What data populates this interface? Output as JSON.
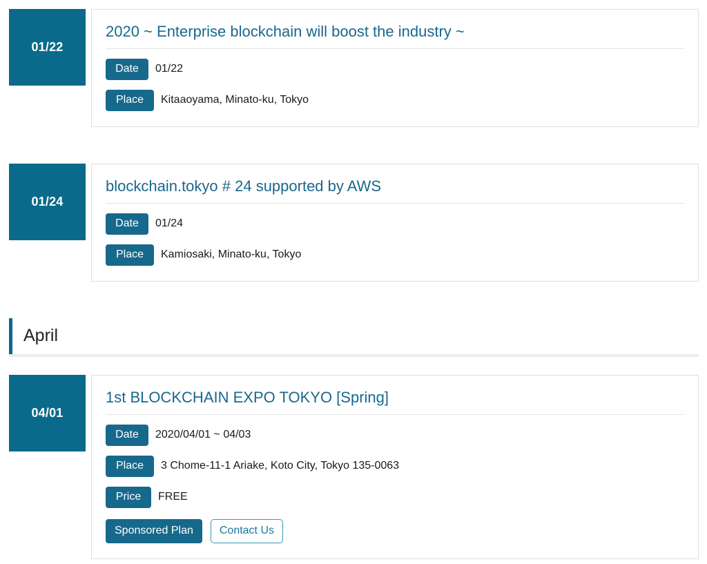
{
  "colors": {
    "accent": "#0a6a8b",
    "badge": "#17698c",
    "title_link": "#19688c",
    "outline_button_border": "#2f9cb4",
    "outline_button_text": "#19799a",
    "card_border": "#dedede",
    "divider": "#eaecec"
  },
  "sections": [
    {
      "type": "event",
      "date_block": "01/22",
      "title": "2020 ~ Enterprise blockchain will boost the industry ~",
      "meta": [
        {
          "label": "Date",
          "value": "01/22"
        },
        {
          "label": "Place",
          "value": "Kitaaoyama, Minato-ku, Tokyo"
        }
      ],
      "actions": []
    },
    {
      "type": "event",
      "date_block": "01/24",
      "title": "blockchain.tokyo # 24 supported by AWS",
      "meta": [
        {
          "label": "Date",
          "value": "01/24"
        },
        {
          "label": "Place",
          "value": "Kamiosaki, Minato-ku, Tokyo"
        }
      ],
      "actions": []
    },
    {
      "type": "month",
      "name": "April"
    },
    {
      "type": "event",
      "date_block": "04/01",
      "title": "1st BLOCKCHAIN EXPO TOKYO [Spring]",
      "meta": [
        {
          "label": "Date",
          "value": "2020/04/01 ~ 04/03"
        },
        {
          "label": "Place",
          "value": "3 Chome-11-1 Ariake, Koto City, Tokyo 135-0063"
        },
        {
          "label": "Price",
          "value": "FREE"
        }
      ],
      "actions": [
        {
          "style": "solid",
          "label": "Sponsored Plan"
        },
        {
          "style": "outline",
          "label": "Contact Us"
        }
      ]
    }
  ]
}
